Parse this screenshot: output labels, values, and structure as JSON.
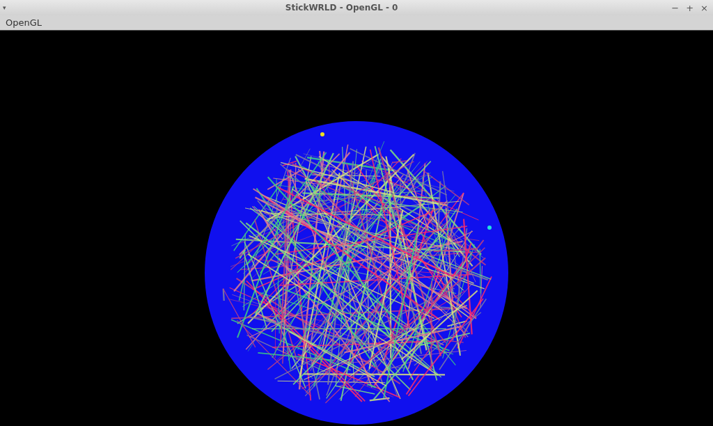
{
  "window": {
    "title": "StickWRLD - OpenGL - 0",
    "menu_glyph": "▾",
    "controls": [
      "−",
      "+",
      "×"
    ]
  },
  "menu_bar": {
    "items": [
      "OpenGL"
    ]
  }
}
